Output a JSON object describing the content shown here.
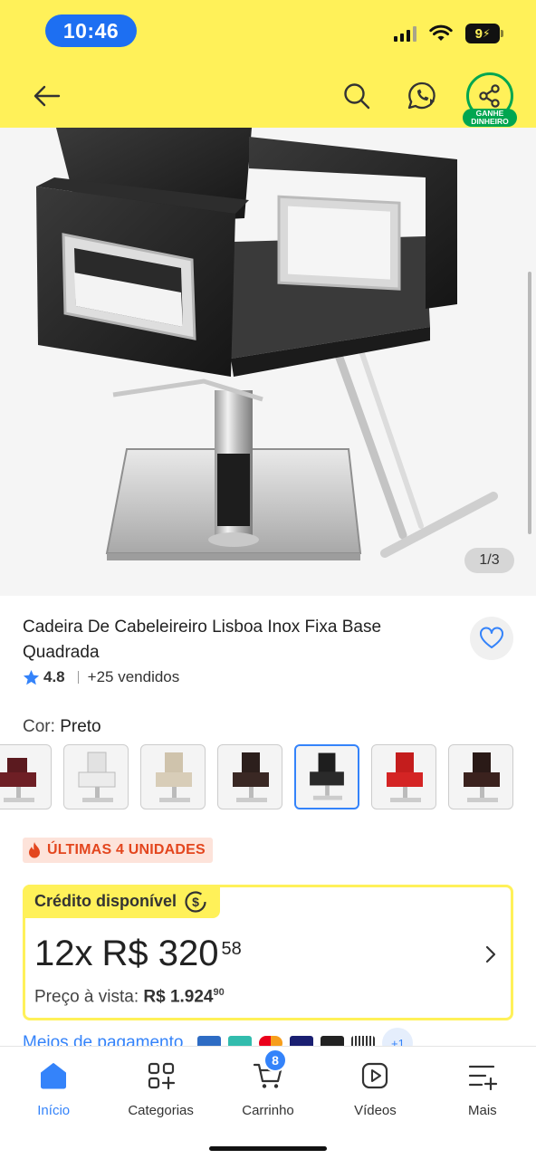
{
  "status_bar": {
    "time": "10:46",
    "battery": "9"
  },
  "header": {
    "back_icon": "arrow-left-icon",
    "search_icon": "search-icon",
    "chat_icon": "whatsapp-chat-icon",
    "share_icon": "share-icon",
    "share_tag": "GANHE DINHEIRO",
    "bg_color": "#fff159"
  },
  "gallery": {
    "counter": "1/3"
  },
  "product": {
    "title": "Cadeira De Cabeleireiro Lisboa Inox Fixa Base Quadrada",
    "rating": "4.8",
    "sold": "+25 vendidos",
    "color_label": "Cor:",
    "color_value": "Preto",
    "color_options": [
      "Vinho",
      "Branco",
      "Bege",
      "Marrom",
      "Preto",
      "Vermelho",
      "Marrom escuro"
    ],
    "selected_color_index": 4,
    "stock_badge": "ÚLTIMAS 4 UNIDADES"
  },
  "credit": {
    "tag": "Crédito disponível",
    "installments": "12x",
    "amount": "R$ 320",
    "cents": "58",
    "cash_label": "Preço à vista:",
    "cash_amount": "R$ 1.924",
    "cash_cents": "90"
  },
  "payment": {
    "link": "Meios de pagamento",
    "more": "+1"
  },
  "bottom_nav": {
    "items": [
      {
        "label": "Início",
        "icon": "home-icon"
      },
      {
        "label": "Categorias",
        "icon": "categories-icon"
      },
      {
        "label": "Carrinho",
        "icon": "cart-icon"
      },
      {
        "label": "Vídeos",
        "icon": "video-icon"
      },
      {
        "label": "Mais",
        "icon": "menu-plus-icon"
      }
    ],
    "cart_count": "8"
  },
  "colors": {
    "accent": "#3483fa",
    "yellow": "#fff159",
    "green": "#00a650",
    "urgent": "#e3461e"
  }
}
